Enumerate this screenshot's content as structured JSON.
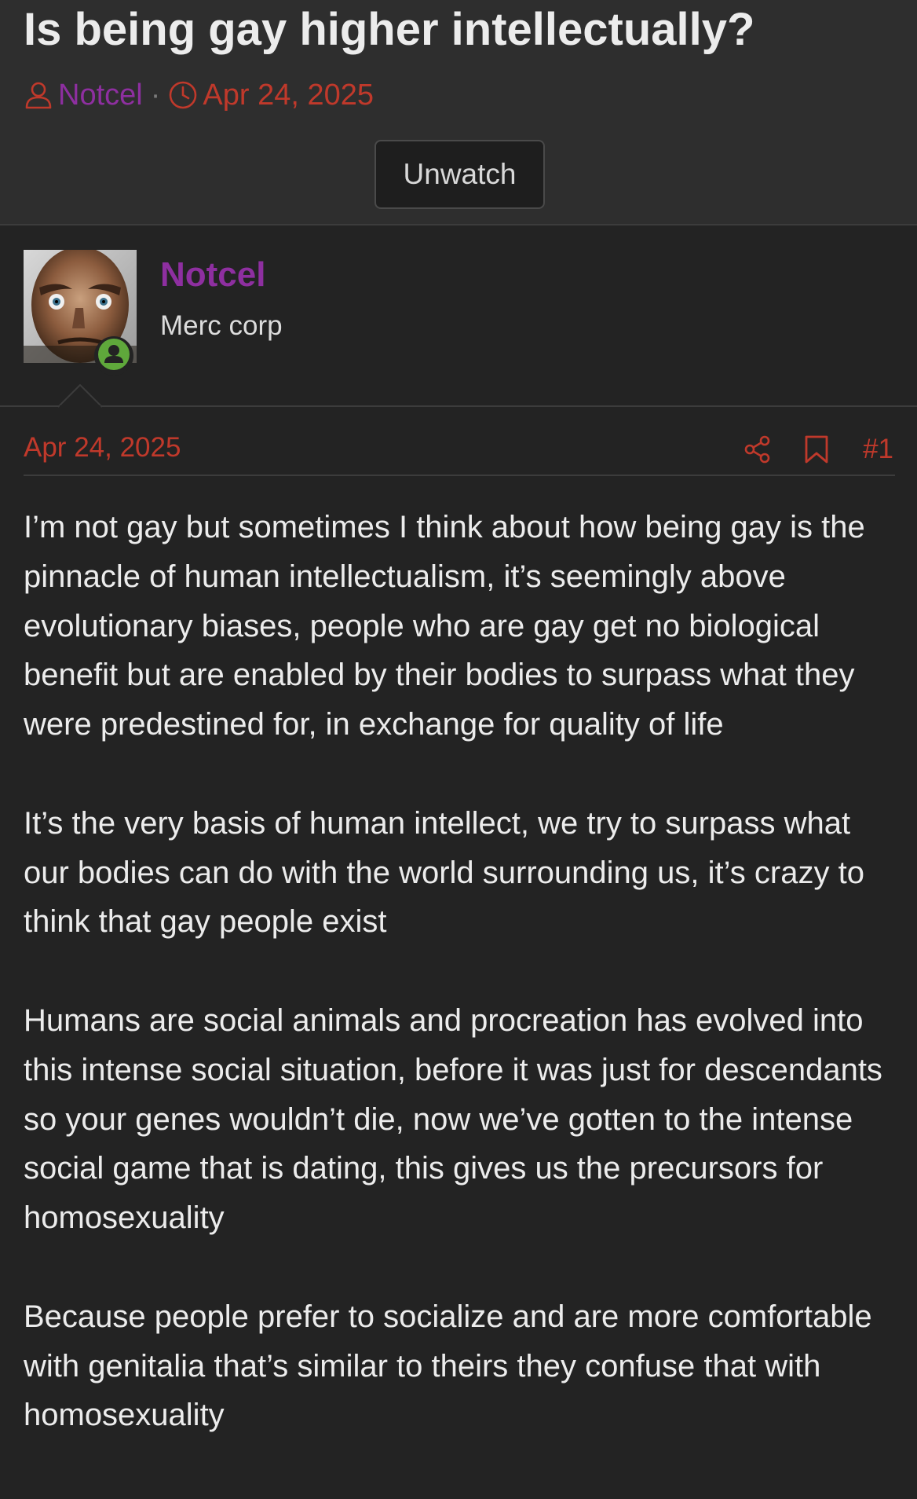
{
  "thread": {
    "title": "Is being gay higher intellectually?",
    "author": "Notcel",
    "separator": "·",
    "date": "Apr 24, 2025",
    "watch_button_label": "Unwatch"
  },
  "user": {
    "name": "Notcel",
    "title": "Merc corp",
    "status": "online"
  },
  "post": {
    "date": "Apr 24, 2025",
    "number": "#1",
    "paragraphs": [
      "I’m not gay but sometimes I think about how being gay is the pinnacle of human intellectualism, it’s seemingly above evolutionary biases, people who are gay get no biological benefit but are enabled by their bodies to surpass what they were predestined for, in exchange for quality of life",
      "It’s the very basis of human intellect, we try to surpass what our bodies can do with the world surrounding us, it’s crazy to think that gay people exist",
      "Humans are social animals and procreation has evolved into this intense social situation, before it was just for descendants so your genes wouldn’t die, now we’ve gotten to the intense social game that is dating, this gives us the precursors for homosexuality",
      "Because people prefer to socialize and are more comfortable with genitalia that’s similar to theirs they confuse that with homosexuality"
    ]
  },
  "colors": {
    "accent_purple": "#8e2fa0",
    "accent_red": "#c0392b",
    "online_green": "#5fa83b",
    "background": "#232323",
    "header_background": "#2e2e2e"
  },
  "icons": {
    "author": "user-icon",
    "date": "clock-icon",
    "share": "share-icon",
    "bookmark": "bookmark-icon",
    "status": "online-user-icon"
  }
}
